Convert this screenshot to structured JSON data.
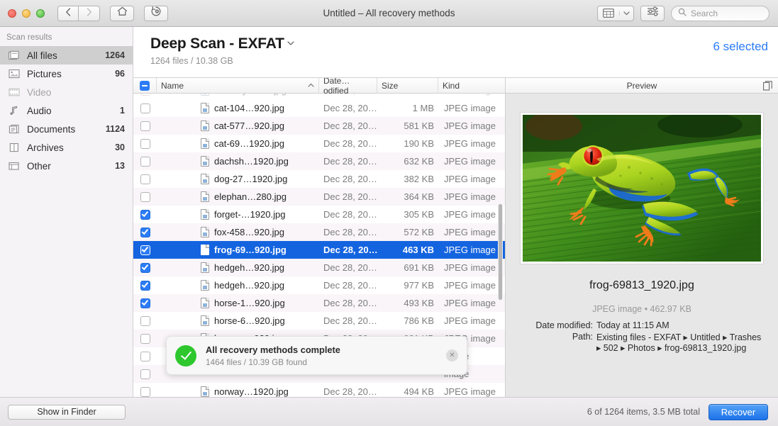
{
  "window": {
    "title": "Untitled – All recovery methods",
    "traffic_lights": [
      "close",
      "minimize",
      "maximize"
    ]
  },
  "toolbar": {
    "back_icon": "chevron-left-icon",
    "forward_icon": "chevron-right-icon",
    "home_icon": "home-icon",
    "history_icon": "history-clock-icon",
    "viewmode_icon": "grid-view-icon",
    "viewmode_chevron": "chevron-down-icon",
    "filter_icon": "sliders-icon",
    "search": {
      "placeholder": "Search",
      "value": "",
      "icon": "search-icon"
    }
  },
  "sidebar": {
    "header": "Scan results",
    "items": [
      {
        "label": "All files",
        "count": "1264",
        "icon": "files-stack-icon",
        "selected": true,
        "muted": false
      },
      {
        "label": "Pictures",
        "count": "96",
        "icon": "picture-icon",
        "selected": false,
        "muted": false
      },
      {
        "label": "Video",
        "count": "",
        "icon": "film-icon",
        "selected": false,
        "muted": true
      },
      {
        "label": "Audio",
        "count": "1",
        "icon": "music-note-icon",
        "selected": false,
        "muted": false
      },
      {
        "label": "Documents",
        "count": "1124",
        "icon": "document-icon",
        "selected": false,
        "muted": false
      },
      {
        "label": "Archives",
        "count": "30",
        "icon": "archive-box-icon",
        "selected": false,
        "muted": false
      },
      {
        "label": "Other",
        "count": "13",
        "icon": "other-files-icon",
        "selected": false,
        "muted": false
      }
    ],
    "show_in_finder": "Show in Finder"
  },
  "content_header": {
    "scan_title": "Deep Scan - EXFAT",
    "scan_title_chevron": "chevron-down-icon",
    "scan_subtitle": "1264 files / 10.38 GB",
    "selected_label": "6 selected",
    "accent_color": "#2b7cf6"
  },
  "table": {
    "header_checkbox_state": "indeterminate",
    "columns": [
      {
        "key": "name",
        "label": "Name",
        "sorted": "asc",
        "sort_icon": "chevron-up-icon"
      },
      {
        "key": "date",
        "label": "Date…odified"
      },
      {
        "key": "size",
        "label": "Size"
      },
      {
        "key": "kind",
        "label": "Kind"
      }
    ],
    "rows": [
      {
        "name": "cat-104…920.jpg",
        "date": "Dec 28, 20…",
        "size": "1 MB",
        "kind": "JPEG image",
        "checked": false,
        "active": false
      },
      {
        "name": "cat-577…920.jpg",
        "date": "Dec 28, 20…",
        "size": "581 KB",
        "kind": "JPEG image",
        "checked": false,
        "active": false
      },
      {
        "name": "cat-69…1920.jpg",
        "date": "Dec 28, 20…",
        "size": "190 KB",
        "kind": "JPEG image",
        "checked": false,
        "active": false
      },
      {
        "name": "dachsh…1920.jpg",
        "date": "Dec 28, 20…",
        "size": "632 KB",
        "kind": "JPEG image",
        "checked": false,
        "active": false
      },
      {
        "name": "dog-27…1920.jpg",
        "date": "Dec 28, 20…",
        "size": "382 KB",
        "kind": "JPEG image",
        "checked": false,
        "active": false
      },
      {
        "name": "elephan…280.jpg",
        "date": "Dec 28, 20…",
        "size": "364 KB",
        "kind": "JPEG image",
        "checked": false,
        "active": false
      },
      {
        "name": "forget-…1920.jpg",
        "date": "Dec 28, 20…",
        "size": "305 KB",
        "kind": "JPEG image",
        "checked": true,
        "active": false
      },
      {
        "name": "fox-458…920.jpg",
        "date": "Dec 28, 20…",
        "size": "572 KB",
        "kind": "JPEG image",
        "checked": true,
        "active": false
      },
      {
        "name": "frog-69…920.jpg",
        "date": "Dec 28, 20…",
        "size": "463 KB",
        "kind": "JPEG image",
        "checked": true,
        "active": true
      },
      {
        "name": "hedgeh…920.jpg",
        "date": "Dec 28, 20…",
        "size": "691 KB",
        "kind": "JPEG image",
        "checked": true,
        "active": false
      },
      {
        "name": "hedgeh…920.jpg",
        "date": "Dec 28, 20…",
        "size": "977 KB",
        "kind": "JPEG image",
        "checked": true,
        "active": false
      },
      {
        "name": "horse-1…920.jpg",
        "date": "Dec 28, 20…",
        "size": "493 KB",
        "kind": "JPEG image",
        "checked": true,
        "active": false
      },
      {
        "name": "horse-6…920.jpg",
        "date": "Dec 28, 20…",
        "size": "786 KB",
        "kind": "JPEG image",
        "checked": false,
        "active": false
      },
      {
        "name": "horses-…920.jpg",
        "date": "Dec 28, 20…",
        "size": "901 KB",
        "kind": "JPEG image",
        "checked": false,
        "active": false
      },
      {
        "name": "",
        "date": "",
        "size": "",
        "kind": "image",
        "checked": false,
        "active": false
      },
      {
        "name": "",
        "date": "",
        "size": "",
        "kind": "image",
        "checked": false,
        "active": false
      },
      {
        "name": "norway…1920.jpg",
        "date": "Dec 28, 20…",
        "size": "494 KB",
        "kind": "JPEG image",
        "checked": false,
        "active": false
      }
    ]
  },
  "preview": {
    "header": "Preview",
    "copy_icon": "copy-pages-icon",
    "image_alt": "red-eyed tree frog on a green leaf",
    "file_name": "frog-69813_1920.jpg",
    "type_and_size": "JPEG image • 462.97 KB",
    "fields": [
      {
        "key": "Date modified:",
        "value": "Today at 11:15 AM"
      },
      {
        "key": "Path:",
        "value": "Existing files - EXFAT ▸ Untitled ▸ Trashes ▸ 502 ▸ Photos ▸ frog-69813_1920.jpg"
      }
    ]
  },
  "toast": {
    "icon": "success-check-icon",
    "title": "All recovery methods complete",
    "subtitle": "1464 files / 10.39 GB found",
    "close_icon": "close-icon",
    "success_color": "#2ec82e"
  },
  "bottom_bar": {
    "status": "6 of 1264 items, 3.5 MB total",
    "recover_label": "Recover",
    "recover_color": "#1c72e8"
  }
}
